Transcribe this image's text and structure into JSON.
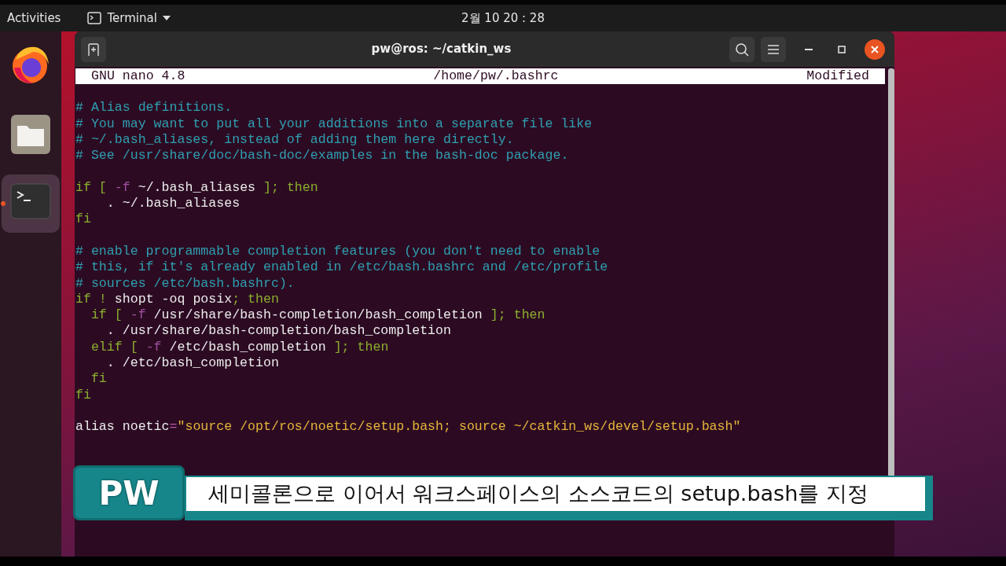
{
  "top_bar": {
    "activities": "Activities",
    "app_menu": "Terminal",
    "clock": "2월 10 20 : 28"
  },
  "dock": [
    {
      "kind": "browser",
      "selected": false,
      "running": false
    },
    {
      "kind": "files",
      "selected": false,
      "running": false
    },
    {
      "kind": "terminal",
      "selected": true,
      "running": true
    }
  ],
  "window": {
    "title": "pw@ros: ~/catkin_ws"
  },
  "nano_header": {
    "version": "GNU nano 4.8",
    "file": "/home/pw/.bashrc",
    "status": "Modified"
  },
  "lines": [
    {
      "kind": "blank"
    },
    {
      "kind": "code",
      "segments": [
        {
          "kind": "comment",
          "text": "# Alias definitions."
        }
      ]
    },
    {
      "kind": "code",
      "segments": [
        {
          "kind": "comment",
          "text": "# You may want to put all your additions into a separate file like"
        }
      ]
    },
    {
      "kind": "code",
      "segments": [
        {
          "kind": "comment",
          "text": "# ~/.bash_aliases, instead of adding them here directly."
        }
      ]
    },
    {
      "kind": "code",
      "segments": [
        {
          "kind": "comment",
          "text": "# See /usr/share/doc/bash-doc/examples in the bash-doc package."
        }
      ]
    },
    {
      "kind": "blank"
    },
    {
      "kind": "code",
      "segments": [
        {
          "kind": "keyword",
          "text": "if [ "
        },
        {
          "kind": "flag",
          "text": "-f"
        },
        {
          "kind": "plain",
          "text": " ~/.bash_aliases"
        },
        {
          "kind": "keyword",
          "text": " ]; then"
        }
      ]
    },
    {
      "kind": "code",
      "segments": [
        {
          "kind": "plain",
          "text": "    . ~/.bash_aliases"
        }
      ]
    },
    {
      "kind": "code",
      "segments": [
        {
          "kind": "keyword",
          "text": "fi"
        }
      ]
    },
    {
      "kind": "blank"
    },
    {
      "kind": "code",
      "segments": [
        {
          "kind": "comment",
          "text": "# enable programmable completion features (you don't need to enable"
        }
      ]
    },
    {
      "kind": "code",
      "segments": [
        {
          "kind": "comment",
          "text": "# this, if it's already enabled in /etc/bash.bashrc and /etc/profile"
        }
      ]
    },
    {
      "kind": "code",
      "segments": [
        {
          "kind": "comment",
          "text": "# sources /etc/bash.bashrc)."
        }
      ]
    },
    {
      "kind": "code",
      "segments": [
        {
          "kind": "keyword",
          "text": "if ! "
        },
        {
          "kind": "plain",
          "text": "shopt -oq posix"
        },
        {
          "kind": "keyword",
          "text": "; then"
        }
      ]
    },
    {
      "kind": "code",
      "segments": [
        {
          "kind": "keyword",
          "text": "  if [ "
        },
        {
          "kind": "flag",
          "text": "-f"
        },
        {
          "kind": "plain",
          "text": " /usr/share/bash-completion/bash_completion"
        },
        {
          "kind": "keyword",
          "text": " ]; then"
        }
      ]
    },
    {
      "kind": "code",
      "segments": [
        {
          "kind": "plain",
          "text": "    . /usr/share/bash-completion/bash_completion"
        }
      ]
    },
    {
      "kind": "code",
      "segments": [
        {
          "kind": "keyword",
          "text": "  elif [ "
        },
        {
          "kind": "flag",
          "text": "-f"
        },
        {
          "kind": "plain",
          "text": " /etc/bash_completion"
        },
        {
          "kind": "keyword",
          "text": " ]; then"
        }
      ]
    },
    {
      "kind": "code",
      "segments": [
        {
          "kind": "plain",
          "text": "    . /etc/bash_completion"
        }
      ]
    },
    {
      "kind": "code",
      "segments": [
        {
          "kind": "keyword",
          "text": "  fi"
        }
      ]
    },
    {
      "kind": "code",
      "segments": [
        {
          "kind": "keyword",
          "text": "fi"
        }
      ]
    },
    {
      "kind": "blank"
    },
    {
      "kind": "code",
      "segments": [
        {
          "kind": "plain",
          "text": "alias noetic"
        },
        {
          "kind": "operator",
          "text": "="
        },
        {
          "kind": "string",
          "text": "\"source /opt/ros/noetic/setup.bash; source ~/catkin_ws/devel/setup.bash\""
        }
      ]
    },
    {
      "kind": "blank"
    },
    {
      "kind": "blank"
    }
  ],
  "caption": {
    "logo": "PW",
    "text": "세미콜론으로 이어서 워크스페이스의 소스코드의 setup.bash를 지정"
  }
}
